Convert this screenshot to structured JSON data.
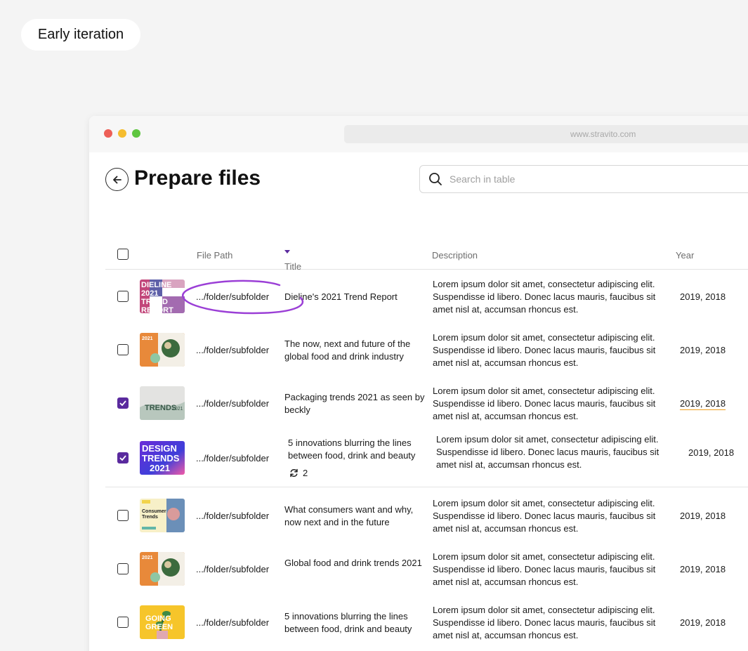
{
  "badge": {
    "label": "Early iteration"
  },
  "browser": {
    "url": "www.stravito.com"
  },
  "header": {
    "title": "Prepare files",
    "search_placeholder": "Search in table"
  },
  "table": {
    "columns": {
      "file_path": "File Path",
      "title": "Title",
      "description": "Description",
      "year": "Year"
    },
    "rows": [
      {
        "checked": false,
        "path": ".../folder/subfolder",
        "title": "Dieline's 2021 Trend Report",
        "description": "Lorem ipsum dolor sit amet, consectetur adipiscing elit. Suspendisse id libero. Donec lacus mauris, faucibus sit amet nisl at, accumsan rhoncus est.",
        "year": "2019, 2018",
        "thumb_text": "DIELINE 2021 TREND REPORT"
      },
      {
        "checked": false,
        "path": ".../folder/subfolder",
        "title": "The now, next and future of the global food and drink industry",
        "description": "Lorem ipsum dolor sit amet, consectetur adipiscing elit. Suspendisse id libero. Donec lacus mauris, faucibus sit amet nisl at, accumsan rhoncus est.",
        "year": "2019, 2018",
        "thumb_text": "2021"
      },
      {
        "checked": true,
        "path": ".../folder/subfolder",
        "title": "Packaging trends 2021 as seen by beckly",
        "description": "Lorem ipsum dolor sit amet, consectetur adipiscing elit. Suspendisse id libero. Donec lacus mauris, faucibus sit amet nisl at, accumsan rhoncus est.",
        "year": "2019, 2018",
        "thumb_text": "TRENDS 2021"
      },
      {
        "checked": true,
        "path": ".../folder/subfolder",
        "title": "5 innovations blurring the lines between food, drink and beauty",
        "description": "Lorem ipsum dolor sit amet, consectetur adipiscing elit. Suspendisse id libero. Donec lacus mauris, faucibus sit amet nisl at, accumsan rhoncus est.",
        "year": "2019, 2018",
        "versions": "2",
        "thumb_text": "DESIGN TRENDS 2021"
      },
      {
        "checked": false,
        "path": ".../folder/subfolder",
        "title": "What consumers want and why, now next and in the future",
        "description": "Lorem ipsum dolor sit amet, consectetur adipiscing elit. Suspendisse id libero. Donec lacus mauris, faucibus sit amet nisl at, accumsan rhoncus est.",
        "year": "2019, 2018",
        "thumb_text": "Consumer Trends"
      },
      {
        "checked": false,
        "path": ".../folder/subfolder",
        "title": "Global food and drink trends 2021",
        "description": "Lorem ipsum dolor sit amet, consectetur adipiscing elit. Suspendisse id libero. Donec lacus mauris, faucibus sit amet nisl at, accumsan rhoncus est.",
        "year": "2019, 2018",
        "thumb_text": "2021"
      },
      {
        "checked": false,
        "path": ".../folder/subfolder",
        "title": "5 innovations blurring the lines between food, drink and beauty",
        "description": "Lorem ipsum dolor sit amet, consectetur adipiscing elit. Suspendisse id libero. Donec lacus mauris, faucibus sit amet nisl at, accumsan rhoncus est.",
        "year": "2019, 2018",
        "thumb_text": "GOING GREEN"
      }
    ]
  },
  "colors": {
    "accent": "#5a2a9e",
    "highlight_circle": "#9b3fd6",
    "year_underline": "#f0a020"
  }
}
